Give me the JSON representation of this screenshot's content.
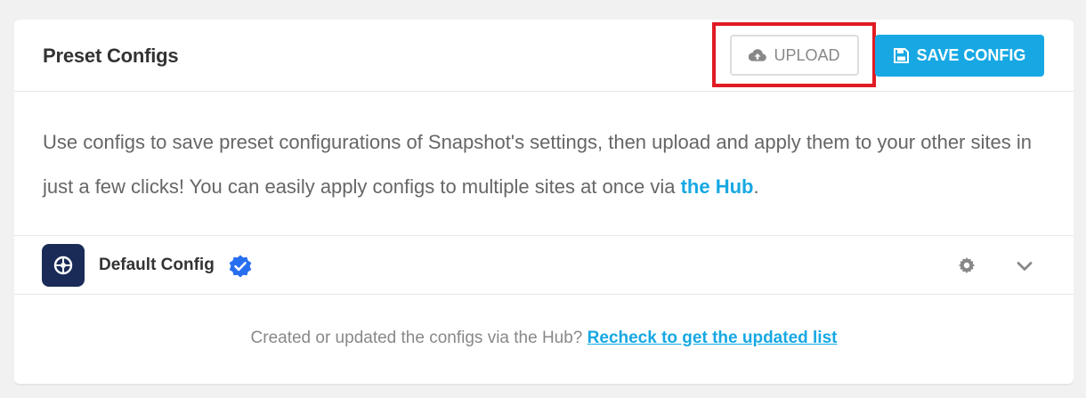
{
  "header": {
    "title": "Preset Configs",
    "upload_label": "UPLOAD",
    "save_label": "SAVE CONFIG"
  },
  "description": {
    "text": "Use configs to save preset configurations of Snapshot's settings, then upload and apply them to your other sites in just a few clicks! You can easily apply configs to multiple sites at once via ",
    "link": "the Hub",
    "end": "."
  },
  "config": {
    "name": "Default Config"
  },
  "footer": {
    "text": "Created or updated the configs via the Hub? ",
    "link": "Recheck to get the updated list"
  },
  "icons": {
    "upload": "cloud-upload-icon",
    "save": "floppy-disk-icon",
    "verified": "verified-badge-icon",
    "settings": "gear-icon",
    "expand": "chevron-down-icon",
    "logo": "snapshot-logo"
  },
  "colors": {
    "accent": "#17a8e3",
    "highlight": "#e01b24",
    "logo_bg": "#1a2b57",
    "verified": "#286ef1"
  }
}
